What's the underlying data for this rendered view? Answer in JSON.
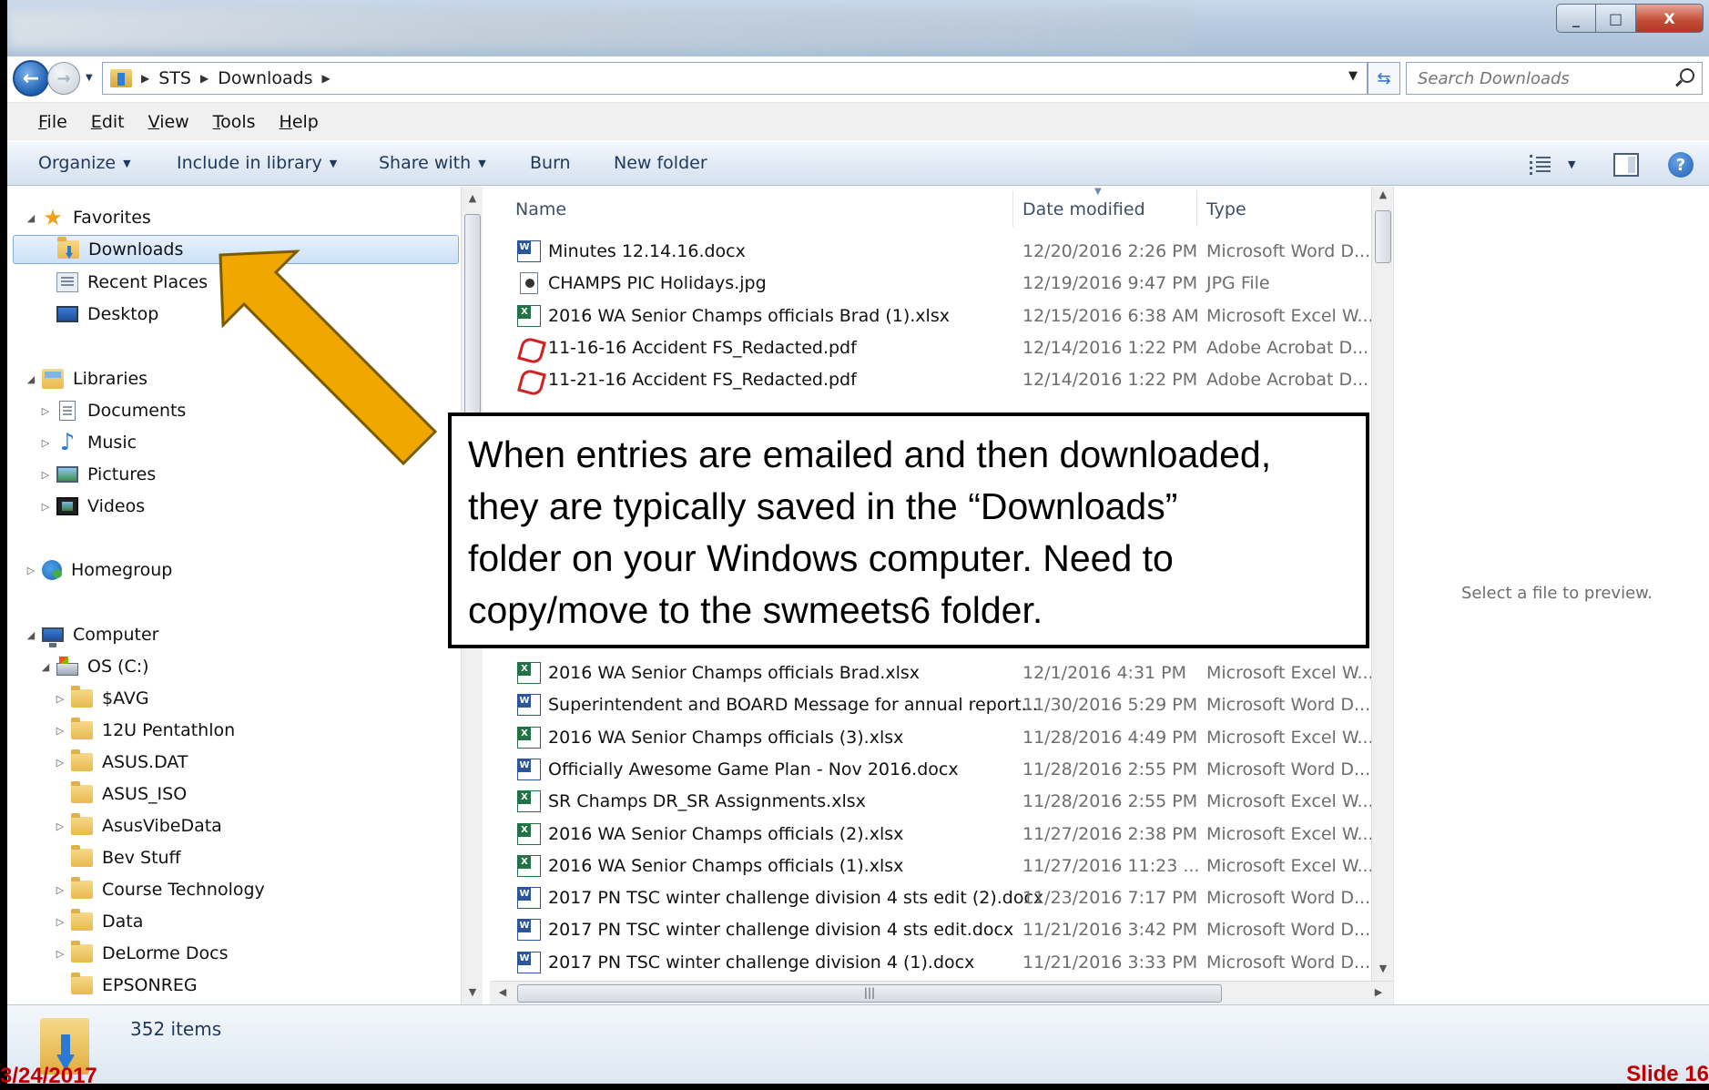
{
  "window": {
    "close_label": "X",
    "minimize_label": "_",
    "maximize_label": "□"
  },
  "address": {
    "crumbs": [
      "STS",
      "Downloads"
    ],
    "search_placeholder": "Search Downloads"
  },
  "menu": [
    "File",
    "Edit",
    "View",
    "Tools",
    "Help"
  ],
  "commands": {
    "organize": "Organize",
    "include": "Include in library",
    "share": "Share with",
    "burn": "Burn",
    "new_folder": "New folder"
  },
  "nav": {
    "favorites": "Favorites",
    "downloads": "Downloads",
    "recent": "Recent Places",
    "desktop": "Desktop",
    "libraries": "Libraries",
    "documents": "Documents",
    "music": "Music",
    "pictures": "Pictures",
    "videos": "Videos",
    "homegroup": "Homegroup",
    "computer": "Computer",
    "os_drive": "OS (C:)",
    "folders": [
      "$AVG",
      "12U Pentathlon",
      "ASUS.DAT",
      "ASUS_ISO",
      "AsusVibeData",
      "Bev Stuff",
      "Course Technology",
      "Data",
      "DeLorme Docs",
      "EPSONREG"
    ]
  },
  "columns": {
    "name": "Name",
    "date": "Date modified",
    "type": "Type"
  },
  "files_top": [
    {
      "name": "Minutes 12.14.16.docx",
      "date": "12/20/2016 2:26 PM",
      "type": "Microsoft Word D...",
      "icon": "word-icon"
    },
    {
      "name": "CHAMPS PIC Holidays.jpg",
      "date": "12/19/2016 9:47 PM",
      "type": "JPG File",
      "icon": "jpg-icon"
    },
    {
      "name": "2016 WA Senior Champs officials Brad (1).xlsx",
      "date": "12/15/2016 6:38 AM",
      "type": "Microsoft Excel W...",
      "icon": "excel-icon"
    },
    {
      "name": "11-16-16 Accident FS_Redacted.pdf",
      "date": "12/14/2016 1:22 PM",
      "type": "Adobe Acrobat D...",
      "icon": "pdf-icon"
    },
    {
      "name": "11-21-16 Accident FS_Redacted.pdf",
      "date": "12/14/2016 1:22 PM",
      "type": "Adobe Acrobat D...",
      "icon": "pdf-icon"
    }
  ],
  "files_bottom": [
    {
      "name": "2016 WA Senior Champs officials Brad.xlsx",
      "date": "12/1/2016 4:31 PM",
      "type": "Microsoft Excel W...",
      "icon": "excel-icon"
    },
    {
      "name": "Superintendent and BOARD Message for annual report...",
      "date": "11/30/2016 5:29 PM",
      "type": "Microsoft Word D...",
      "icon": "word-icon"
    },
    {
      "name": "2016 WA Senior Champs officials (3).xlsx",
      "date": "11/28/2016 4:49 PM",
      "type": "Microsoft Excel W...",
      "icon": "excel-icon"
    },
    {
      "name": "Officially Awesome Game Plan - Nov 2016.docx",
      "date": "11/28/2016 2:55 PM",
      "type": "Microsoft Word D...",
      "icon": "word-icon"
    },
    {
      "name": "SR Champs DR_SR Assignments.xlsx",
      "date": "11/28/2016 2:55 PM",
      "type": "Microsoft Excel W...",
      "icon": "excel-icon"
    },
    {
      "name": "2016 WA Senior Champs officials (2).xlsx",
      "date": "11/27/2016 2:38 PM",
      "type": "Microsoft Excel W...",
      "icon": "excel-icon"
    },
    {
      "name": "2016 WA Senior Champs officials (1).xlsx",
      "date": "11/27/2016 11:23 ...",
      "type": "Microsoft Excel W...",
      "icon": "excel-icon"
    },
    {
      "name": "2017 PN TSC winter challenge division 4 sts edit (2).docx",
      "date": "11/23/2016 7:17 PM",
      "type": "Microsoft Word D...",
      "icon": "word-icon"
    },
    {
      "name": "2017 PN TSC winter challenge division 4 sts edit.docx",
      "date": "11/21/2016 3:42 PM",
      "type": "Microsoft Word D...",
      "icon": "word-icon"
    },
    {
      "name": "2017 PN TSC winter challenge division 4 (1).docx",
      "date": "11/21/2016 3:33 PM",
      "type": "Microsoft Word D...",
      "icon": "word-icon"
    }
  ],
  "preview_text": "Select a file to preview.",
  "status": {
    "count": "352 items"
  },
  "callout": {
    "lines": [
      "When entries are emailed and then downloaded,",
      "they are typically saved in the “Downloads”",
      "folder on your Windows computer.  Need to",
      "copy/move to the swmeets6 folder."
    ]
  },
  "slide": {
    "date": "3/24/2017",
    "number": "Slide 16"
  },
  "colors": {
    "arrow_fill": "#f0a800",
    "arrow_stroke": "#7a5c00",
    "slide_text": "#c00000"
  }
}
